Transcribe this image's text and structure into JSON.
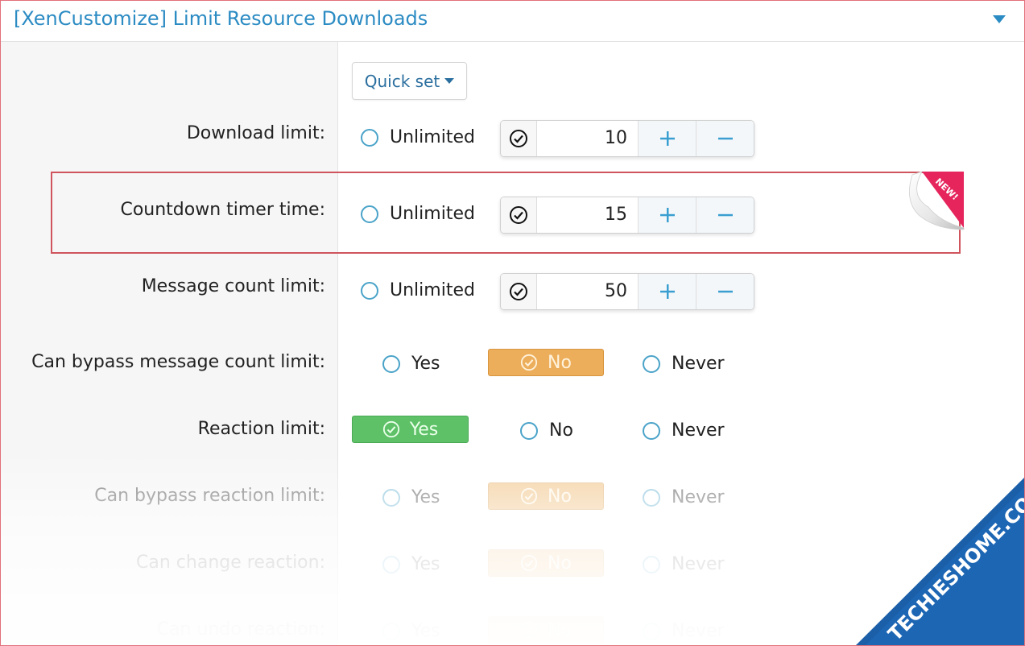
{
  "header": {
    "title": "[XenCustomize] Limit Resource Downloads"
  },
  "quick_set": {
    "label": "Quick set"
  },
  "number_rows": [
    {
      "label": "Download limit:",
      "unlimited_label": "Unlimited",
      "value": "10"
    },
    {
      "label": "Countdown timer time:",
      "unlimited_label": "Unlimited",
      "value": "15"
    },
    {
      "label": "Message count limit:",
      "unlimited_label": "Unlimited",
      "value": "50"
    }
  ],
  "choice_rows": [
    {
      "label": "Can bypass message count limit:",
      "options": [
        "Yes",
        "No",
        "Never"
      ],
      "selected": "No"
    },
    {
      "label": "Reaction limit:",
      "options": [
        "Yes",
        "No",
        "Never"
      ],
      "selected": "Yes"
    },
    {
      "label": "Can bypass reaction limit:",
      "options": [
        "Yes",
        "No",
        "Never"
      ],
      "selected": "No"
    },
    {
      "label": "Can change reaction:",
      "options": [
        "Yes",
        "No",
        "Never"
      ],
      "selected": "No"
    },
    {
      "label": "Can undo reaction:",
      "options": [
        "Yes",
        "No",
        "Never"
      ],
      "selected": "No"
    }
  ],
  "badge": {
    "text": "NEW!"
  },
  "watermark": {
    "text": "TECHIESHOME.COM"
  },
  "icons": {
    "collapse": "caret-down-icon",
    "check": "check-circle-icon",
    "plus": "plus-icon",
    "minus": "minus-icon"
  },
  "colors": {
    "accent": "#2b8bc3",
    "selected_no": "#ecae5b",
    "selected_yes": "#5ec168",
    "highlight_border": "#cf545d",
    "badge": "#e5255c",
    "watermark": "#1b5fa8"
  }
}
